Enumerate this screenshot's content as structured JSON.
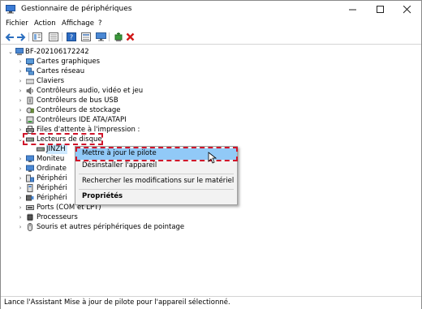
{
  "window": {
    "title": "Gestionnaire de périphériques"
  },
  "menu": [
    "Fichier",
    "Action",
    "Affichage",
    "?"
  ],
  "toolbar": {
    "icons": [
      "back-arrow-icon",
      "forward-arrow-icon",
      "show-hide-icon",
      "properties-sheet-icon",
      "help-icon",
      "view-list-icon",
      "monitor-icon",
      "update-driver-icon",
      "uninstall-x-icon"
    ]
  },
  "tree": {
    "root": "BF-202106172242",
    "categories": [
      "Cartes graphiques",
      "Cartes réseau",
      "Claviers",
      "Contrôleurs audio, vidéo et jeu",
      "Contrôleurs de bus USB",
      "Contrôleurs de stockage",
      "Contrôleurs IDE ATA/ATAPI",
      "Files d'attente à l'impression :",
      "Lecteurs de disque",
      "JINZH",
      "Moniteu",
      "Ordinate",
      "Périphéri",
      "Périphéri",
      "Périphéri",
      "Ports (COM et LPT)",
      "Processeurs",
      "Souris et autres périphériques de pointage"
    ]
  },
  "context_menu": {
    "update": "Mettre à jour le pilote",
    "uninstall": "Désinstaller l'appareil",
    "scan": "Rechercher les modifications sur le matériel",
    "properties": "Propriétés"
  },
  "status": "Lance l'Assistant Mise à jour de pilote pour l'appareil sélectionné.",
  "colors": {
    "highlight": "#d0142a",
    "menu_selected": "#91c9f7",
    "selection": "#cce8ff"
  }
}
